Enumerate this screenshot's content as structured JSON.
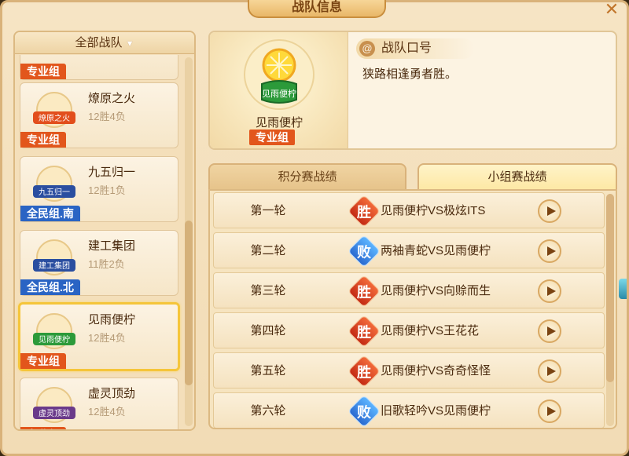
{
  "window": {
    "title": "战队信息"
  },
  "left": {
    "filter_label": "全部战队",
    "partial_top_tag": "专业组",
    "teams": [
      {
        "name": "燎原之火",
        "record": "12胜4负",
        "group": "专业组",
        "group_type": "pro",
        "emblem_text": "燎原之火",
        "emblem_color": "#e24e1c"
      },
      {
        "name": "九五归一",
        "record": "12胜1负",
        "group": "全民组.南",
        "group_type": "all",
        "emblem_text": "九五归一",
        "emblem_color": "#2a4ea0"
      },
      {
        "name": "建工集团",
        "record": "11胜2负",
        "group": "全民组.北",
        "group_type": "all",
        "emblem_text": "建工集团",
        "emblem_color": "#2a4ea0"
      },
      {
        "name": "见雨便柠",
        "record": "12胜4负",
        "group": "专业组",
        "group_type": "pro",
        "emblem_text": "见雨便柠",
        "emblem_color": "#2c9a3a"
      },
      {
        "name": "虚灵顶劲",
        "record": "12胜4负",
        "group": "专业组",
        "group_type": "pro",
        "emblem_text": "虚灵顶劲",
        "emblem_color": "#6a3a8a"
      }
    ]
  },
  "selected_team": {
    "name": "见雨便柠",
    "emblem_text": "见雨便柠",
    "group": "专业组",
    "slogan_title": "战队口号",
    "slogan": "狭路相逢勇者胜。"
  },
  "tabs": {
    "points": "积分赛战绩",
    "group": "小组赛战绩"
  },
  "matches": [
    {
      "round": "第一轮",
      "result": "胜",
      "result_type": "win",
      "matchup": "见雨便柠VS极炫ITS"
    },
    {
      "round": "第二轮",
      "result": "败",
      "result_type": "lose",
      "matchup": "两袖青蛇VS见雨便柠"
    },
    {
      "round": "第三轮",
      "result": "胜",
      "result_type": "win",
      "matchup": "见雨便柠VS向赊而生"
    },
    {
      "round": "第四轮",
      "result": "胜",
      "result_type": "win",
      "matchup": "见雨便柠VS王花花"
    },
    {
      "round": "第五轮",
      "result": "胜",
      "result_type": "win",
      "matchup": "见雨便柠VS奇奇怪怪"
    },
    {
      "round": "第六轮",
      "result": "败",
      "result_type": "lose",
      "matchup": "旧歌轻吟VS见雨便柠"
    }
  ],
  "colors": {
    "win": "#d8381c",
    "lose": "#2a7ad8",
    "pro_tag": "#e2561c",
    "all_tag": "#2a64c4"
  }
}
